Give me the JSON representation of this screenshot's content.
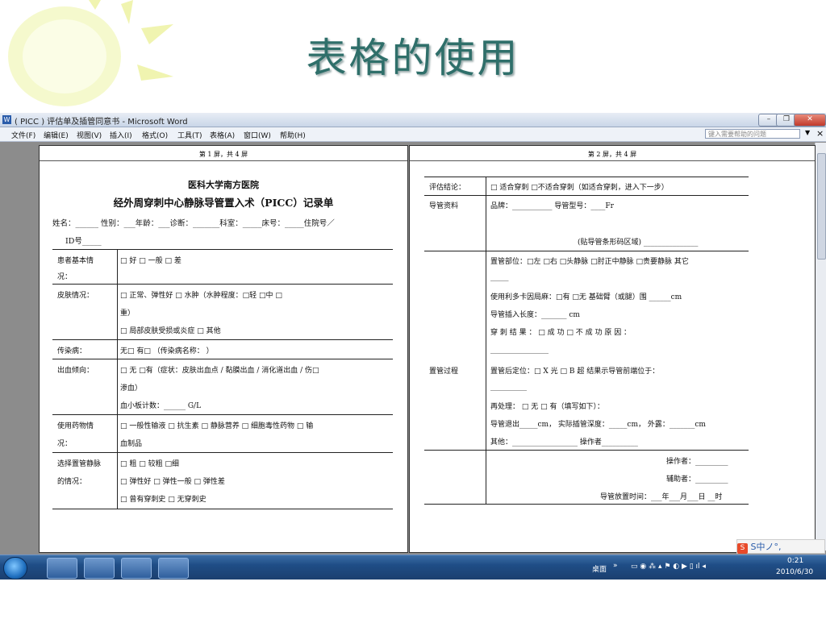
{
  "slide": {
    "title": "表格的使用"
  },
  "window": {
    "title": "( PICC ) 评估单及插管同意书 - Microsoft Word",
    "menu": [
      "文件(F)",
      "编辑(E)",
      "视图(V)",
      "插入(I)",
      "格式(O)",
      "工具(T)",
      "表格(A)",
      "窗口(W)",
      "帮助(H)"
    ],
    "help_placeholder": "键入需要帮助的问题",
    "controls": {
      "minimize": "–",
      "restore": "❐",
      "close": "✕"
    }
  },
  "page1": {
    "header": "第 1 屏，共 4 屏",
    "hospital": "医科大学南方医院",
    "form_title": "经外周穿刺中心静脉导管置入术（PICC）记录单",
    "patient_line": "姓名：______  性别：___年龄：___诊断：_______科室：_____床号：_____住院号／",
    "id_line": "ID号_____",
    "rows": [
      {
        "label1": "患者基本情",
        "label2": "况：",
        "lines": [
          "□ 好          □ 一般        □ 差"
        ]
      },
      {
        "label1": "皮肤情况：",
        "label2": "",
        "lines": [
          "□ 正常、弹性好              □ 水肿（水肿程度：□轻   □中    □",
          "重）",
          "□ 局部皮肤受损或炎症       □ 其他"
        ]
      },
      {
        "label1": "传染病：",
        "label2": "",
        "lines": [
          "无□    有□  （传染病名称：                              ）"
        ]
      },
      {
        "label1": "出血倾向：",
        "label2": "",
        "lines": [
          "□ 无   □有（症状：皮肤出血点 / 黏膜出血 / 消化道出血 / 伤□",
          "渗血）",
          "血小板计数：______ G/L"
        ]
      },
      {
        "label1": "使用药物情",
        "label2": "况：",
        "lines": [
          "□ 一般性输液  □ 抗生素  □ 静脉营养  □ 细胞毒性药物  □ 输",
          "血制品"
        ]
      },
      {
        "label1": "选择置管静脉",
        "label2": "的情况：",
        "lines": [
          "□ 粗               □ 较粗              □细",
          "□ 弹性好           □ 弹性一般          □ 弹性差",
          "□ 曾有穿刺史     □ 无穿刺史"
        ]
      }
    ]
  },
  "page2": {
    "header": "第 2 屏，共 4 屏",
    "rows": [
      {
        "label": "评估结论：",
        "lines": [
          "□ 适合穿刺      □不适合穿刺（如适合穿刺，进入下一步）"
        ]
      },
      {
        "label": "导管资料",
        "lines": [
          "品牌：___________ 导管型号：____Fr",
          "",
          "(贴导管条形码区域) _______________"
        ]
      },
      {
        "label": "置管过程",
        "lines": [
          "置管部位：□左 □右 □头静脉  □肘正中静脉  □贵要静脉  其它",
          "_____",
          "使用利多卡因局麻：□有    □无     基础臂（或腿）围 ______cm",
          "导管插入长度：_______ cm",
          "穿 刺 结 果 ： □ 成 功         □ 不 成 功         原 因 ：",
          "________________",
          "置管后定位：□ X 光      □ B 超    结果示导管前端位于：",
          "__________",
          "再处理： □ 无       □ 有（填写如下）：",
          "导管退出_____cm， 实际插管深度：_____cm， 外露：_______cm",
          "其他：__________________         操作者__________"
        ]
      },
      {
        "label": "",
        "lines": [
          "操作者：_________",
          "辅助者：_________",
          "导管放置时间：___年___月___日 __时"
        ]
      }
    ]
  },
  "taskbar": {
    "desktop_label": "桌面",
    "time": "0:21",
    "date": "2010/6/30",
    "ime": "S中ノ°,"
  }
}
